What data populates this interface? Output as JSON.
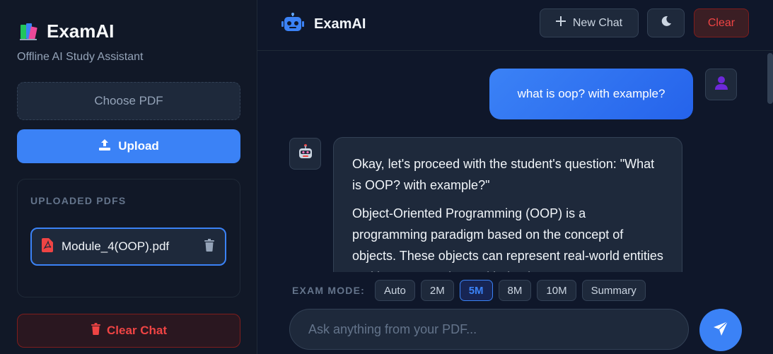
{
  "sidebar": {
    "brand_title": "ExamAI",
    "brand_subtitle": "Offline AI Study Assistant",
    "choose_pdf_label": "Choose PDF",
    "upload_label": "Upload",
    "uploaded_title": "UPLOADED PDFS",
    "pdfs": [
      {
        "name": "Module_4(OOP).pdf",
        "icon": "pdf-icon",
        "delete_icon": "trash-icon"
      }
    ],
    "clear_chat_label": "Clear Chat"
  },
  "header": {
    "title": "ExamAI",
    "logo_icon": "robot-icon",
    "new_chat_label": "New Chat",
    "theme_icon": "moon-icon",
    "clear_label": "Clear"
  },
  "chat": {
    "messages": [
      {
        "role": "user",
        "text": "what is oop? with example?"
      },
      {
        "role": "assistant",
        "paragraphs": [
          "Okay, let's proceed with the student's question: \"What is OOP? with example?\"",
          "Object-Oriented Programming (OOP) is a programming paradigm based on the concept of objects. These objects can represent real-world entities and have properties and behaviors."
        ]
      }
    ]
  },
  "exam_mode": {
    "label": "EXAM MODE:",
    "options": [
      "Auto",
      "2M",
      "5M",
      "8M",
      "10M",
      "Summary"
    ],
    "selected": "5M"
  },
  "input": {
    "placeholder": "Ask anything from your PDF...",
    "value": ""
  },
  "colors": {
    "accent": "#3b82f6",
    "danger": "#ef4444",
    "background": "#0f172a",
    "panel": "#1e293b"
  }
}
